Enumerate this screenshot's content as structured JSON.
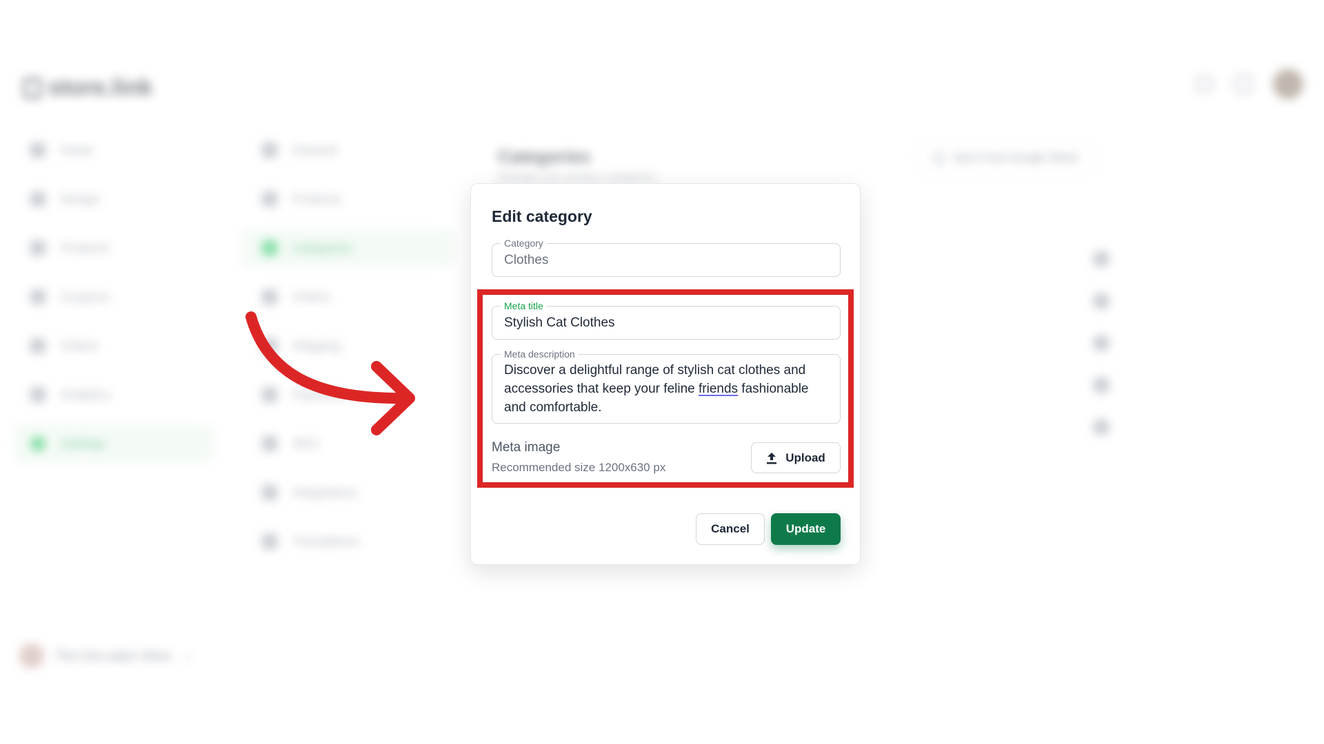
{
  "background": {
    "logo": "store.link",
    "main_nav": [
      "Home",
      "Design",
      "Products",
      "Coupons",
      "Orders",
      "Analytics",
      "Settings"
    ],
    "main_nav_active": 6,
    "settings_nav": [
      "General",
      "Products",
      "Categories",
      "Orders",
      "Shipping",
      "Payments",
      "SEO",
      "Integrations",
      "Translations"
    ],
    "settings_nav_active": 2,
    "page_title": "Categories",
    "page_subtitle": "Manage your product categories",
    "sync_button": "Sync From Google Sheet",
    "store_name": "The Cat Lady's Store"
  },
  "modal": {
    "title": "Edit category",
    "category": {
      "label": "Category",
      "value": "Clothes"
    },
    "meta_title": {
      "label": "Meta title",
      "value": "Stylish Cat Clothes"
    },
    "meta_description": {
      "label": "Meta description",
      "text_before": "Discover a delightful range of stylish cat clothes and accessories that keep your feline ",
      "spell_word": "friends",
      "text_after": " fashionable and comfortable."
    },
    "meta_image": {
      "label": "Meta image",
      "hint": "Recommended size 1200x630 px",
      "upload_label": "Upload"
    },
    "cancel_label": "Cancel",
    "update_label": "Update"
  },
  "colors": {
    "highlight": "#dc2626",
    "primary": "#0e7a4a",
    "focus_label": "#16a34a"
  }
}
